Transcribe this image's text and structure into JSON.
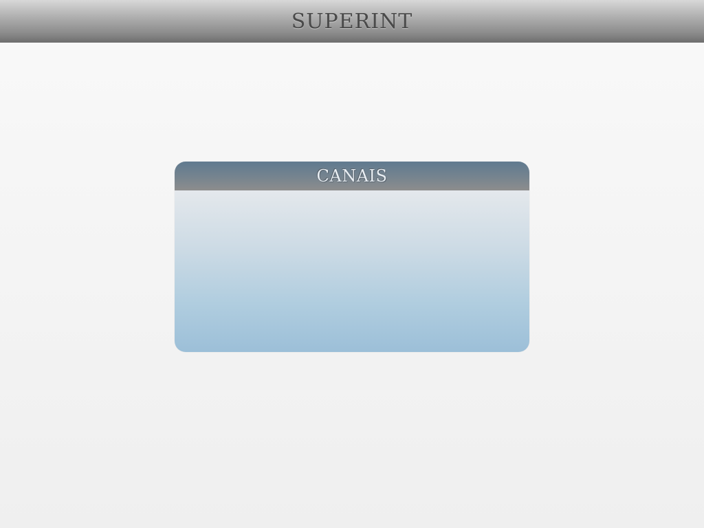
{
  "header": {
    "title": "SUPERINT"
  },
  "panel": {
    "title": "CANAIS"
  }
}
